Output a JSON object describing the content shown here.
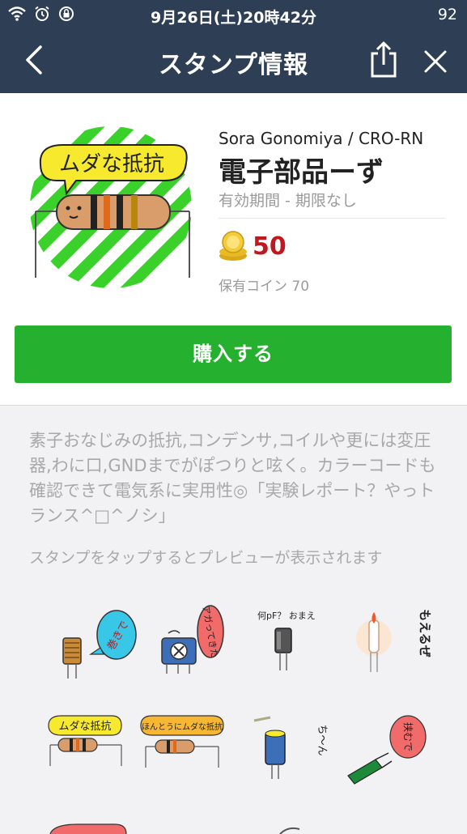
{
  "status_bar": {
    "time": "9月26日(土)20時42分",
    "battery": "92",
    "icons": [
      "wifi-icon",
      "alarm-icon",
      "rotation-lock-icon"
    ]
  },
  "nav": {
    "title": "スタンプ情報",
    "back_icon": "chevron-left-icon",
    "share_icon": "share-icon",
    "close_icon": "close-icon"
  },
  "product": {
    "thumbnail_text": "ムダな抵抗",
    "author": "Sora Gonomiya / CRO-RN",
    "name": "電子部品ーず",
    "validity": "有効期間 - 期限なし",
    "price": "50",
    "owned_coins": "保有コイン 70",
    "buy_label": "購入する"
  },
  "description": "素子おなじみの抵抗,コンデンサ,コイルや更には変圧器,わに口,GNDまでがぽつりと呟く。カラーコードも確認できて電気系に実用性◎「実験レポート？やっトランス^□^ノシ」",
  "preview_hint": "スタンプをタップするとプレビューが表示されます",
  "stickers": [
    {
      "text": "巻きで"
    },
    {
      "text": "アガってきた"
    },
    {
      "text": "何pF？ おまえ"
    },
    {
      "text": "もえるぜ"
    },
    {
      "text": "ムダな抵抗"
    },
    {
      "text": "ほんとうにムダな抵抗"
    },
    {
      "text": "ち〜ん"
    },
    {
      "text": "挟むで"
    }
  ],
  "colors": {
    "header_bg": "#2d3e55",
    "buy_button": "#25b12f",
    "price": "#c0181e",
    "thumb_stripes": "#3ad12a"
  }
}
